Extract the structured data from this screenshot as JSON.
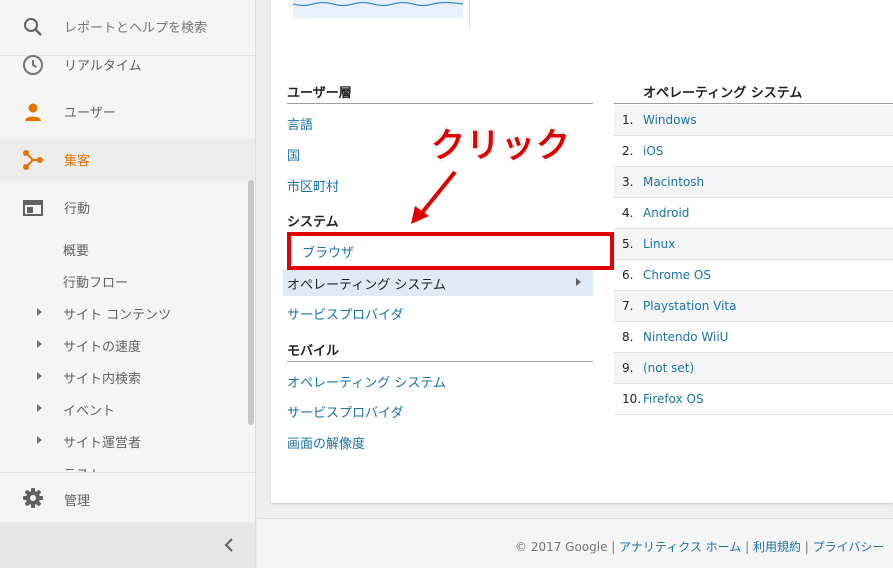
{
  "sidebar": {
    "search_label": "レポートとヘルプを検索",
    "nav": {
      "realtime": "リアルタイム",
      "users": "ユーザー",
      "acquisition": "集客",
      "behavior": "行動"
    },
    "behavior_sub": {
      "overview": "概要",
      "flow": "行動フロー",
      "site_content": "サイト コンテンツ",
      "site_speed": "サイトの速度",
      "site_search": "サイト内検索",
      "events": "イベント",
      "publisher": "サイト運営者",
      "test": "テスト"
    },
    "admin_label": "管理"
  },
  "left_table": {
    "header": "ユーザー層",
    "links_user": [
      "言語",
      "国",
      "市区町村"
    ],
    "system_header": "システム",
    "browser": "ブラウザ",
    "os_selected": "オペレーティング システム",
    "provider": "サービスプロバイダ",
    "mobile_header": "モバイル",
    "mobile_links": [
      "オペレーティング システム",
      "サービスプロバイダ",
      "画面の解像度"
    ]
  },
  "right_table": {
    "header": "オペレーティング システム",
    "rows": [
      {
        "num": "1.",
        "name": "Windows"
      },
      {
        "num": "2.",
        "name": "iOS"
      },
      {
        "num": "3.",
        "name": "Macintosh"
      },
      {
        "num": "4.",
        "name": "Android"
      },
      {
        "num": "5.",
        "name": "Linux"
      },
      {
        "num": "6.",
        "name": "Chrome OS"
      },
      {
        "num": "7.",
        "name": "Playstation Vita"
      },
      {
        "num": "8.",
        "name": "Nintendo WiiU"
      },
      {
        "num": "9.",
        "name": "(not set)"
      },
      {
        "num": "10.",
        "name": "Firefox OS"
      }
    ]
  },
  "annotation": {
    "text": "クリック"
  },
  "footer": {
    "copyright": "© 2017 Google",
    "sep": " | ",
    "home": "アナリティクス ホーム",
    "terms": "利用規約",
    "privacy": "プライバシー"
  },
  "colors": {
    "accent_orange": "#e37400",
    "link_blue": "#1a73a8",
    "annotation_red": "#e00000",
    "highlight_blue": "#dfeaf6"
  }
}
